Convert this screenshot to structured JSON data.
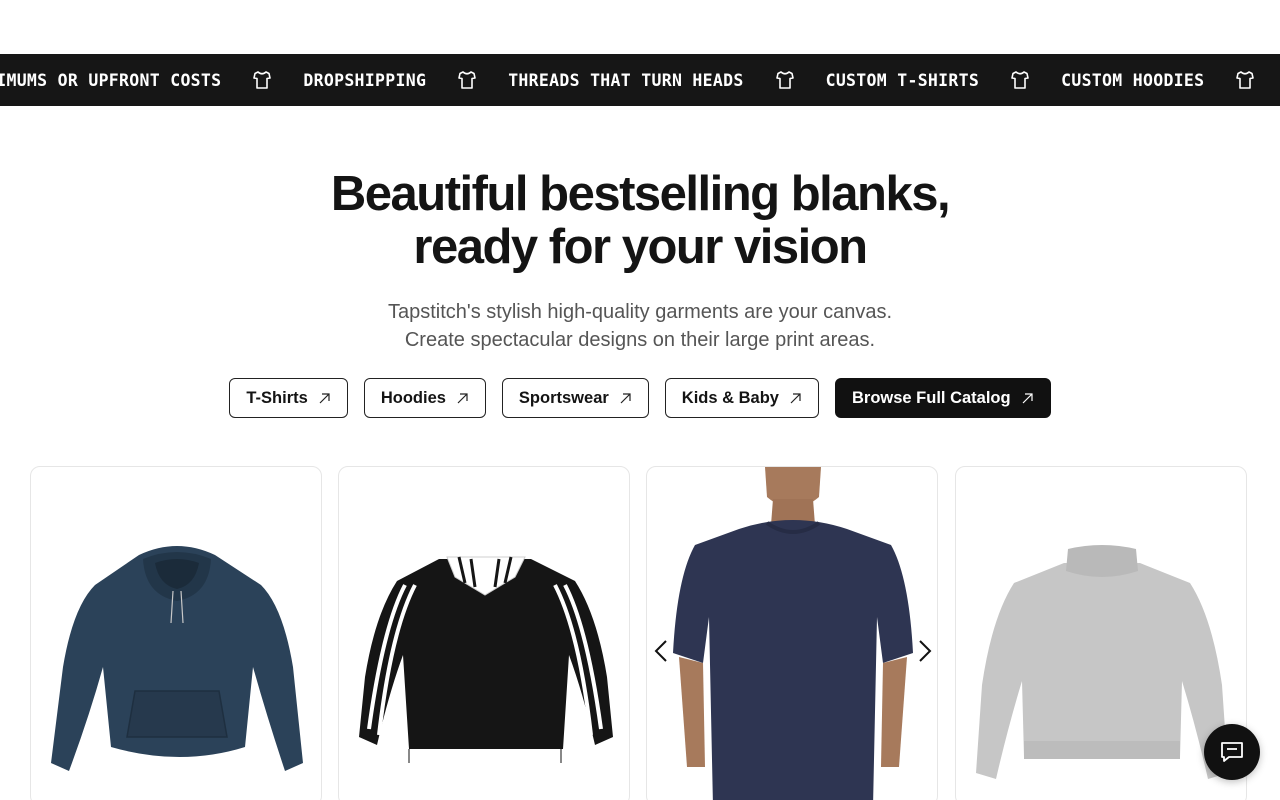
{
  "ticker": {
    "items": [
      "NO MINIMUMS OR UPFRONT COSTS",
      "DROPSHIPPING",
      "THREADS THAT TURN HEADS",
      "CUSTOM T-SHIRTS",
      "CUSTOM HOODIES"
    ],
    "first_item_visible": "NIMUMS OR UPFRONT COSTS",
    "icon": "tshirt-icon"
  },
  "hero": {
    "title_line1": "Beautiful bestselling blanks,",
    "title_line2": "ready for your vision",
    "subtitle_line1": "Tapstitch's stylish high-quality garments are your canvas.",
    "subtitle_line2": "Create spectacular designs on their large print areas."
  },
  "categories": [
    {
      "label": "T-Shirts",
      "icon": "arrow-up-right-icon"
    },
    {
      "label": "Hoodies",
      "icon": "arrow-up-right-icon"
    },
    {
      "label": "Sportswear",
      "icon": "arrow-up-right-icon"
    },
    {
      "label": "Kids & Baby",
      "icon": "arrow-up-right-icon"
    }
  ],
  "catalog_button": {
    "label": "Browse Full Catalog",
    "icon": "arrow-up-right-icon"
  },
  "products": [
    {
      "name": "navy-hoodie",
      "color": "#2b4259"
    },
    {
      "name": "black-striped-polo-sweatshirt",
      "color": "#151515"
    },
    {
      "name": "navy-tshirt-model",
      "color": "#2e3552"
    },
    {
      "name": "grey-mock-neck-sweatshirt",
      "color": "#c6c6c6"
    }
  ],
  "chat": {
    "icon": "chat-icon"
  }
}
